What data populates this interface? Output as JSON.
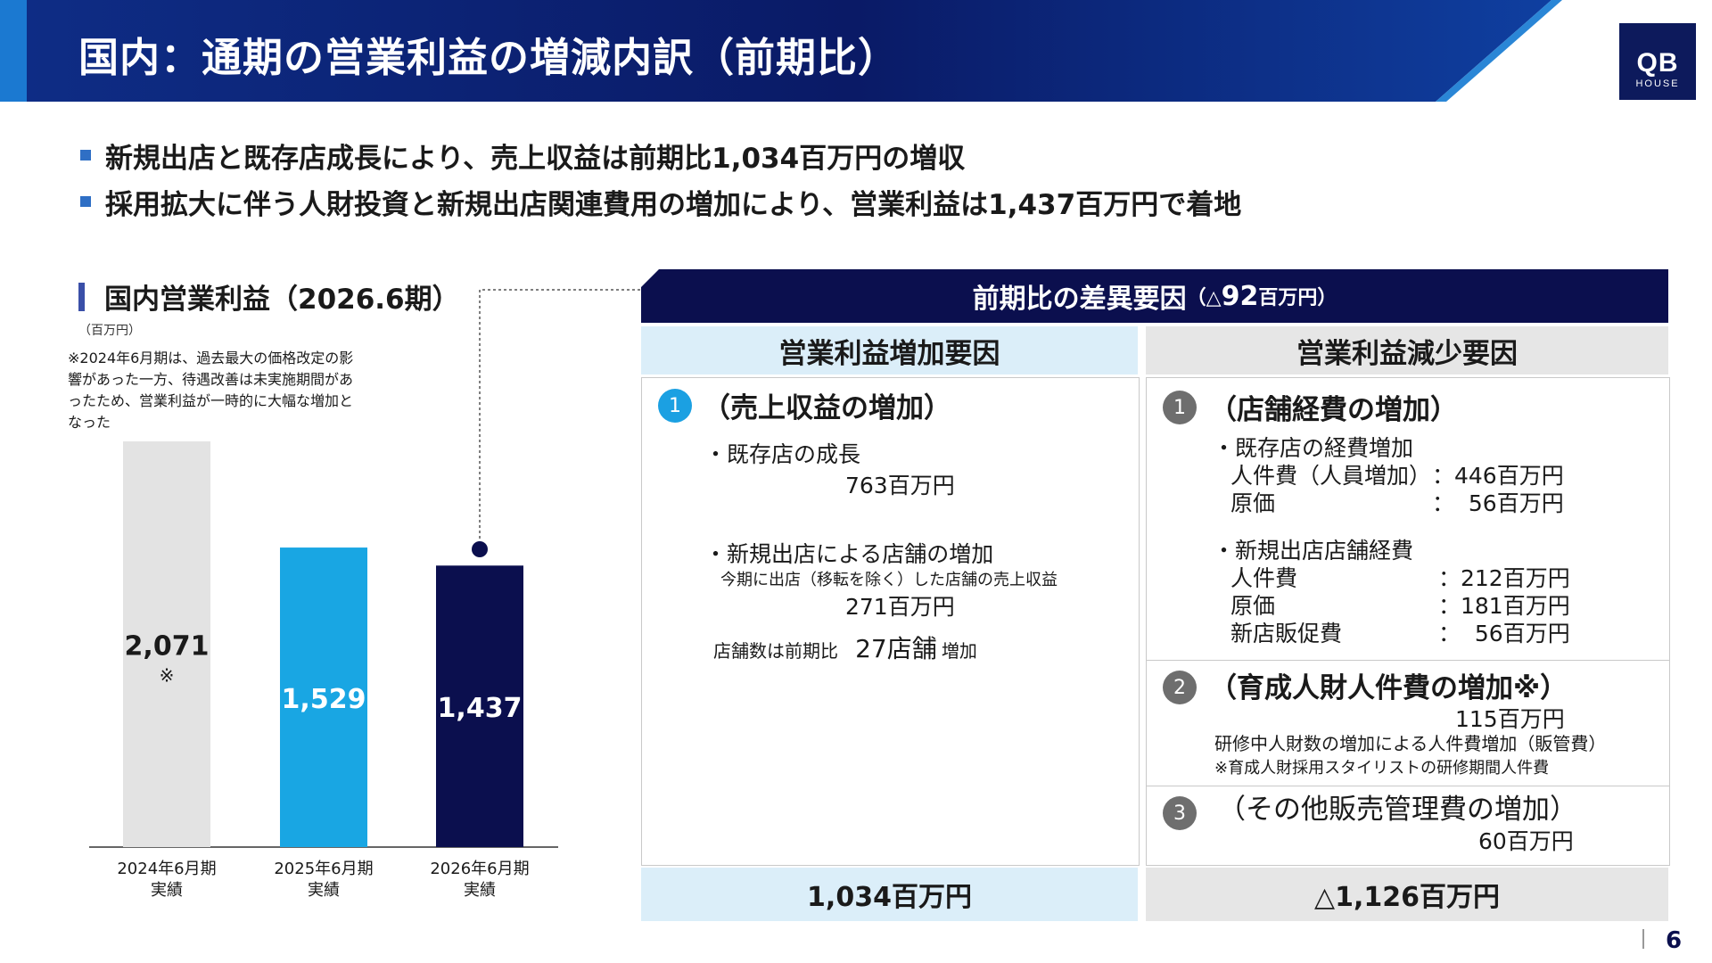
{
  "header": {
    "title": "国内：通期の営業利益の増減内訳（前期比）",
    "logo": {
      "main": "QB",
      "sub": "HOUSE"
    }
  },
  "bullets": [
    "新規出店と既存店成長により、売上収益は前期比1,034百万円の増収",
    "採用拡大に伴う人財投資と新規出店関連費用の増加により、営業利益は1,437百万円で着地"
  ],
  "chart_section": {
    "title": "国内営業利益（2026.6期）",
    "unit": "（百万円）",
    "note": "※2024年6月期は、過去最大の価格改定の影響があった一方、待遇改善は未実施期間があったため、営業利益が一時的に大幅な増加となった"
  },
  "chart_data": {
    "type": "bar",
    "title": "国内営業利益（2026.6期）",
    "unit": "（百万円）",
    "categories": [
      [
        "2024年6月期",
        "実績"
      ],
      [
        "2025年6月期",
        "実績"
      ],
      [
        "2026年6月期",
        "実績"
      ]
    ],
    "values": [
      2071,
      1529,
      1437
    ],
    "value_labels": [
      "2,071",
      "1,529",
      "1,437"
    ],
    "value_notes": [
      "※",
      "",
      ""
    ],
    "colors": [
      "#e3e3e3",
      "#19a6e3",
      "#0b0f4e"
    ],
    "label_colors": [
      "#1a1a1a",
      "#ffffff",
      "#ffffff"
    ],
    "ylim": [
      0,
      2071
    ]
  },
  "table": {
    "header_main": "前期比の差異要因",
    "header_open": "（△",
    "header_num": "92",
    "header_unit": "百万円）",
    "increase": {
      "title": "営業利益増加要因",
      "item1": {
        "num": "1",
        "heading": "（売上収益の増加）",
        "line1": "・既存店の成長",
        "amount1": "763百万円",
        "line2": "・新規出店による店舗の増加",
        "line2_sub": "今期に出店（移転を除く）した店舗の売上収益",
        "amount2": "271百万円",
        "store_prefix": "店舗数は前期比",
        "store_num": "27店舗",
        "store_suffix": "増加"
      },
      "total": "1,034百万円"
    },
    "decrease": {
      "title": "営業利益減少要因",
      "item1": {
        "num": "1",
        "heading": "（店舗経費の増加）",
        "sub1": "・既存店の経費増加",
        "rows1": [
          {
            "label": "人件費（人員増加）",
            "value": "：446百万円"
          },
          {
            "label": "原価",
            "value": "：  56百万円"
          }
        ],
        "sub2": "・新規出店店舗経費",
        "rows2": [
          {
            "label": "人件費",
            "value": "：212百万円"
          },
          {
            "label": "原価",
            "value": "：181百万円"
          },
          {
            "label": "新店販促費",
            "value": "：  56百万円"
          }
        ]
      },
      "item2": {
        "num": "2",
        "heading": "（育成人財人件費の増加※）",
        "amount": "115百万円",
        "desc": "研修中人財数の増加による人件費増加（販管費）",
        "note": "※育成人財採用スタイリストの研修期間人件費"
      },
      "item3": {
        "num": "3",
        "heading": "（その他販売管理費の増加）",
        "amount": "60百万円"
      },
      "total": "△1,126百万円"
    }
  },
  "page_number": "6"
}
